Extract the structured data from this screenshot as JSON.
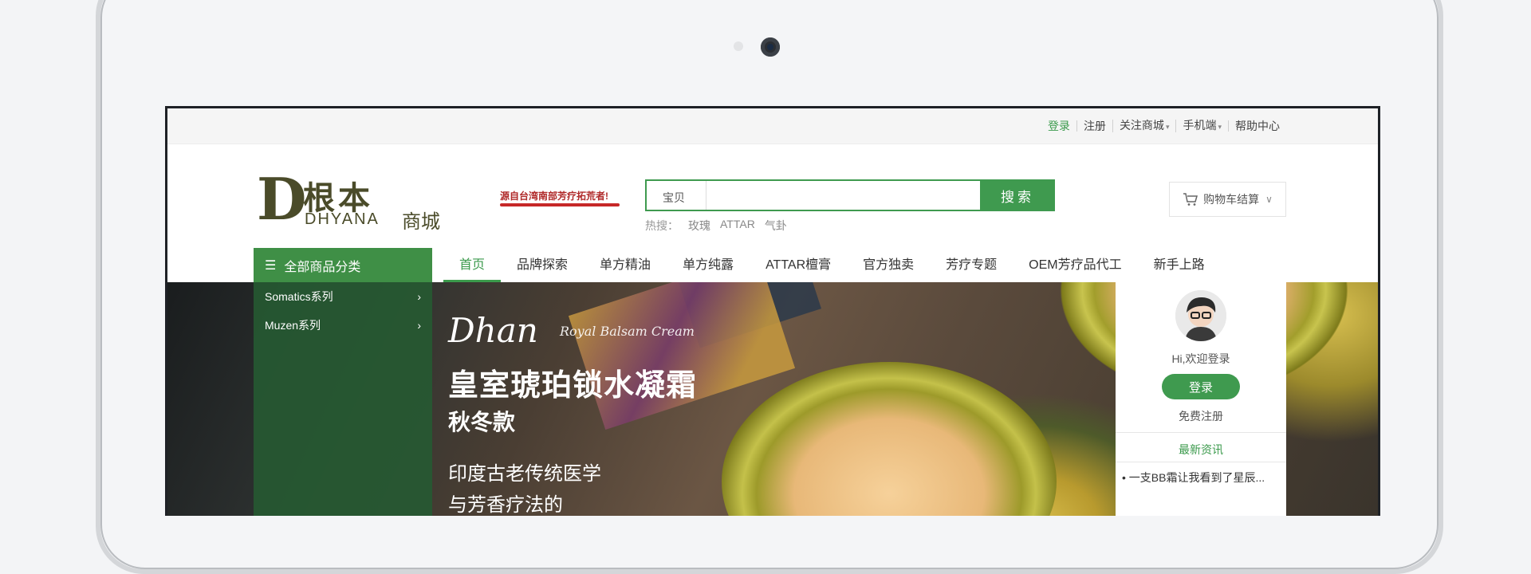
{
  "topbar": {
    "login": "登录",
    "register": "注册",
    "follow": "关注商城",
    "mobile": "手机端",
    "help": "帮助中心"
  },
  "logo": {
    "mark": "D",
    "chinese": "根本",
    "english": "DHYANA",
    "mall": "商城"
  },
  "slogan": "源自台湾南部芳疗拓荒者!",
  "search": {
    "label": "宝贝",
    "placeholder": "",
    "button": "搜索"
  },
  "hot": {
    "label": "热搜：",
    "keywords": [
      "玫瑰",
      "ATTAR",
      "气卦"
    ]
  },
  "cart": {
    "label": "购物车结算"
  },
  "category_button": "全部商品分类",
  "nav": [
    "首页",
    "品牌探索",
    "单方精油",
    "单方纯露",
    "ATTAR檀膏",
    "官方独卖",
    "芳疗专题",
    "OEM芳疗品代工",
    "新手上路"
  ],
  "categories": [
    {
      "label": "Somatics系列"
    },
    {
      "label": "Muzen系列"
    }
  ],
  "banner": {
    "brand": "Dhan",
    "brand_sub": "Royal Balsam Cream",
    "title": "皇室琥珀锁水凝霜",
    "subtitle": "秋冬款",
    "line1": "印度古老传统医学",
    "line2": "与芳香疗法的"
  },
  "userbox": {
    "welcome": "Hi,欢迎登录",
    "login": "登录",
    "register": "免费注册",
    "news_title": "最新资讯",
    "news_item": "• 一支BB霜让我看到了星辰..."
  },
  "colors": {
    "accent": "#3f9a4f",
    "category_bg": "#3f8f46",
    "logo": "#4a4b29"
  }
}
